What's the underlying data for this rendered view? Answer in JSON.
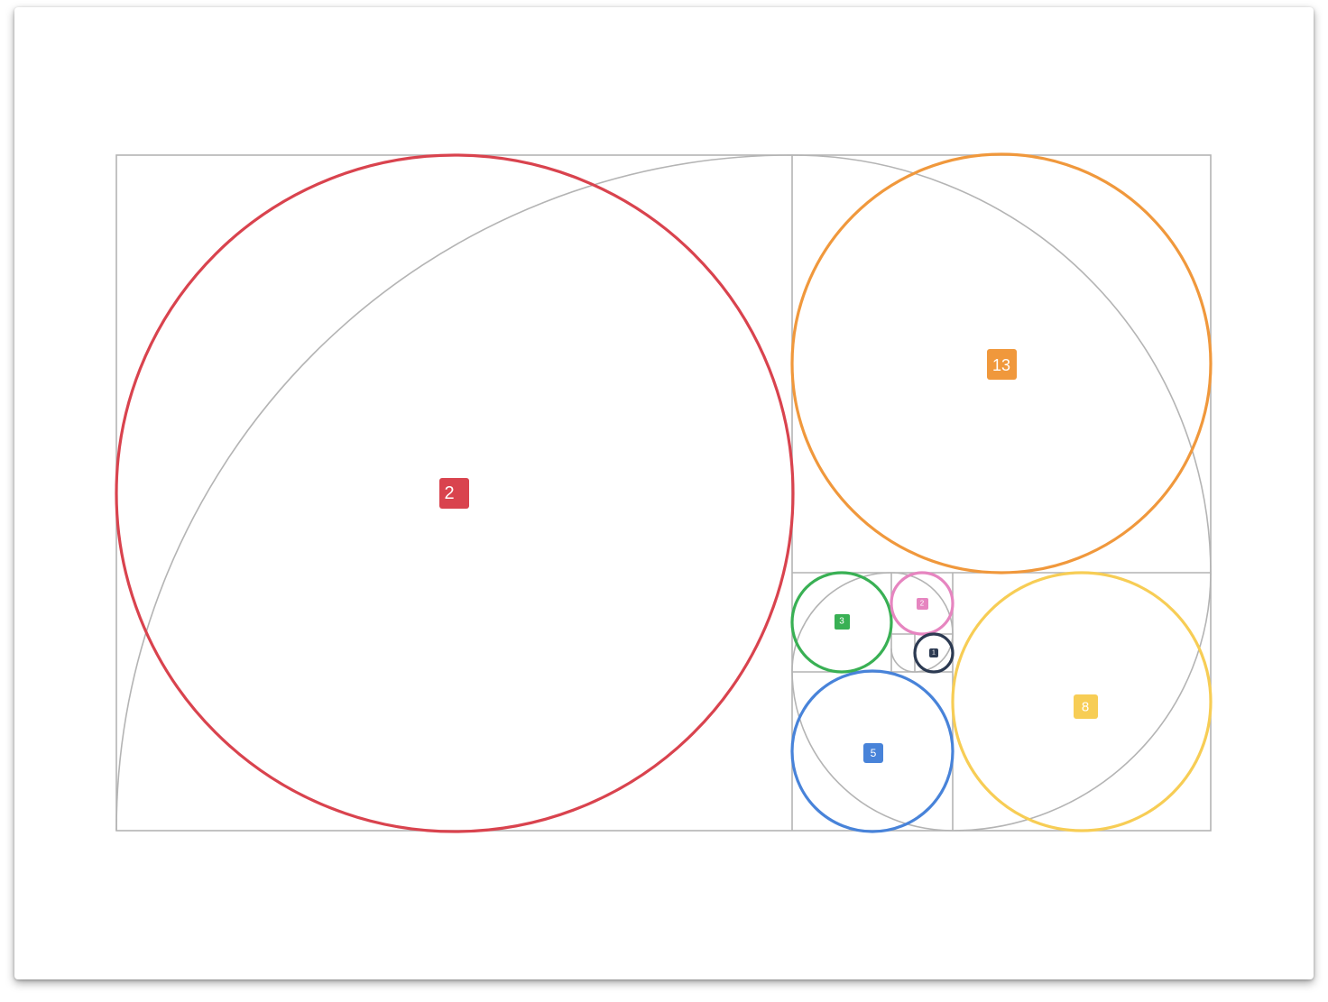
{
  "circles": [
    {
      "id": "red",
      "label": "2",
      "color": "#d9434e"
    },
    {
      "id": "orange",
      "label": "13",
      "color": "#f0983c"
    },
    {
      "id": "yellow",
      "label": "8",
      "color": "#f7cd55"
    },
    {
      "id": "blue",
      "label": "5",
      "color": "#4883d9"
    },
    {
      "id": "green",
      "label": "3",
      "color": "#39b054"
    },
    {
      "id": "pink",
      "label": "2",
      "color": "#e685c0"
    },
    {
      "id": "navy",
      "label": "1",
      "color": "#2c3a52"
    }
  ],
  "guide_color": "#b4b4b4"
}
